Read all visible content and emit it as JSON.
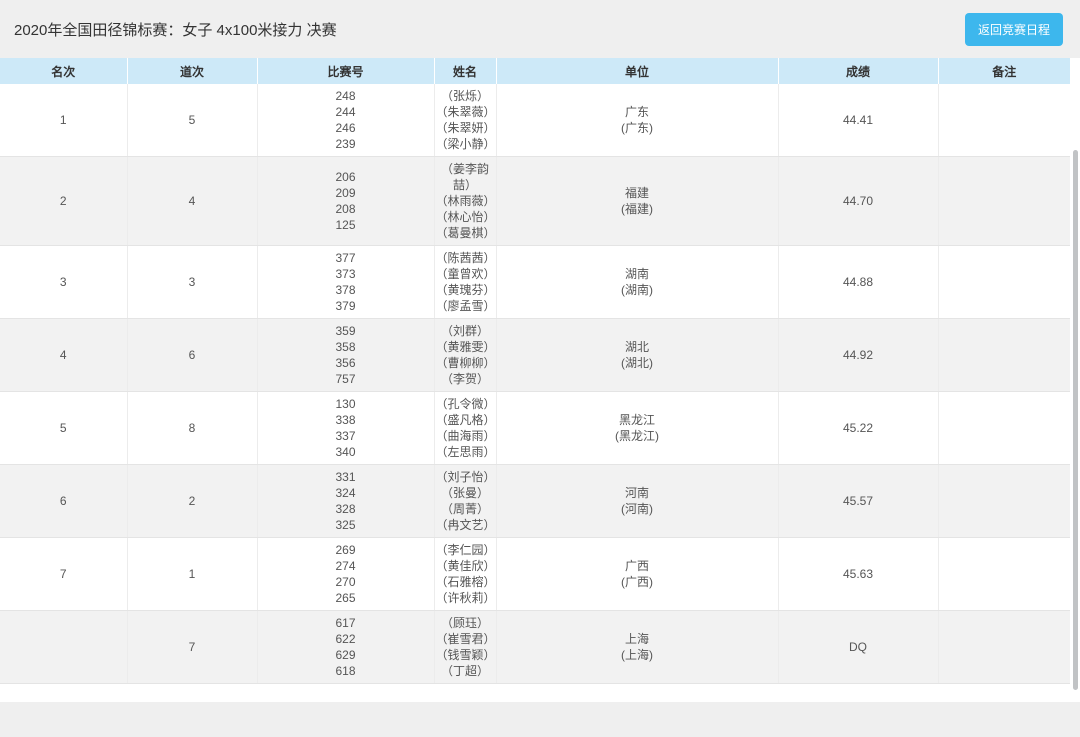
{
  "page": {
    "title": "2020年全国田径锦标赛：女子 4x100米接力 决赛",
    "back_button_label": "返回竞赛日程"
  },
  "colors": {
    "accent_blue": "#3db7ed",
    "header_bg": "#cde9f8",
    "stripe_bg": "#f2f2f2",
    "page_bg": "#efefef",
    "body_text": "#555555"
  },
  "table": {
    "headers": [
      "名次",
      "道次",
      "比赛号",
      "姓名",
      "单位",
      "成绩",
      "备注"
    ],
    "rows": [
      {
        "rank": "1",
        "lane": "5",
        "bibs": [
          "248",
          "244",
          "246",
          "239"
        ],
        "names": [
          "（张烁）",
          "（朱翠薇）",
          "（朱翠妍）",
          "（梁小静）"
        ],
        "unit": "广东",
        "unit_sub": "(广东)",
        "result": "44.41",
        "remark": ""
      },
      {
        "rank": "2",
        "lane": "4",
        "bibs": [
          "206",
          "209",
          "208",
          "125"
        ],
        "names": [
          "（姜李韵喆）",
          "（林雨薇）",
          "（林心怡）",
          "（葛曼棋）"
        ],
        "unit": "福建",
        "unit_sub": "(福建)",
        "result": "44.70",
        "remark": ""
      },
      {
        "rank": "3",
        "lane": "3",
        "bibs": [
          "377",
          "373",
          "378",
          "379"
        ],
        "names": [
          "（陈茜茜）",
          "（童曾欢）",
          "（黄瑰芬）",
          "（廖孟雪）"
        ],
        "unit": "湖南",
        "unit_sub": "(湖南)",
        "result": "44.88",
        "remark": ""
      },
      {
        "rank": "4",
        "lane": "6",
        "bibs": [
          "359",
          "358",
          "356",
          "757"
        ],
        "names": [
          "（刘群）",
          "（黄雅雯）",
          "（曹柳柳）",
          "（李贺）"
        ],
        "unit": "湖北",
        "unit_sub": "(湖北)",
        "result": "44.92",
        "remark": ""
      },
      {
        "rank": "5",
        "lane": "8",
        "bibs": [
          "130",
          "338",
          "337",
          "340"
        ],
        "names": [
          "（孔令微）",
          "（盛凡格）",
          "（曲海雨）",
          "（左思雨）"
        ],
        "unit": "黑龙江",
        "unit_sub": "(黑龙江)",
        "result": "45.22",
        "remark": ""
      },
      {
        "rank": "6",
        "lane": "2",
        "bibs": [
          "331",
          "324",
          "328",
          "325"
        ],
        "names": [
          "（刘子怡）",
          "（张曼）",
          "（周菁）",
          "（冉文艺）"
        ],
        "unit": "河南",
        "unit_sub": "(河南)",
        "result": "45.57",
        "remark": ""
      },
      {
        "rank": "7",
        "lane": "1",
        "bibs": [
          "269",
          "274",
          "270",
          "265"
        ],
        "names": [
          "（李仁园）",
          "（黄佳欣）",
          "（石雅榕）",
          "（许秋莉）"
        ],
        "unit": "广西",
        "unit_sub": "(广西)",
        "result": "45.63",
        "remark": ""
      },
      {
        "rank": "",
        "lane": "7",
        "bibs": [
          "617",
          "622",
          "629",
          "618"
        ],
        "names": [
          "（顾珏）",
          "（崔雪君）",
          "（钱雪颖）",
          "（丁超）"
        ],
        "unit": "上海",
        "unit_sub": "(上海)",
        "result": "DQ",
        "remark": ""
      }
    ]
  }
}
